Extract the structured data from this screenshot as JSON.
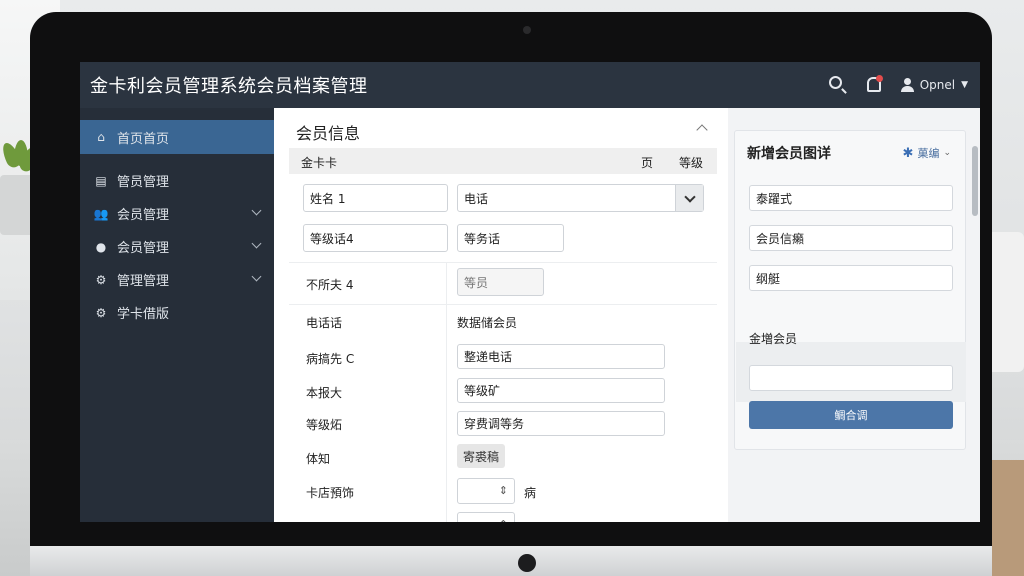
{
  "app": {
    "title": "金卡利会员管理系统会员档案管理"
  },
  "header": {
    "user_name": "Opnel"
  },
  "sidebar": {
    "items": [
      {
        "label": "首页首页",
        "icon": "home-icon",
        "active": true
      },
      {
        "label": "管员管理",
        "icon": "document-icon"
      },
      {
        "label": "会员管理",
        "icon": "users-icon",
        "expandable": true
      },
      {
        "label": "会员管理",
        "icon": "user-icon",
        "expandable": true
      },
      {
        "label": "管理管理",
        "icon": "gear-icon",
        "expandable": true
      },
      {
        "label": "学卡借版",
        "icon": "gear-icon"
      }
    ]
  },
  "main": {
    "section_title": "会员信息",
    "table_head": {
      "col1": "金卡卡",
      "col2": "页",
      "col3": "等级"
    },
    "fields": {
      "name": "姓名 1",
      "phone": "电话",
      "level_phone": "等级话4",
      "level_phone2": "等务话",
      "plain_label": "不所夫 4",
      "plain_value": "等员"
    },
    "rows": [
      {
        "label": "电话话",
        "value": "数据储会员"
      },
      {
        "label": "病搞先 C",
        "value": "整递电话"
      },
      {
        "label": "本报大",
        "value": "等级矿"
      },
      {
        "label": "等级炻",
        "value": "穿费调等务"
      },
      {
        "label": "体知",
        "value": "寄裘稿"
      },
      {
        "label": "卡店預饰",
        "value": "病"
      }
    ]
  },
  "right_panel": {
    "title": "新增会员图详",
    "action_label": "菓编",
    "fields": [
      "泰躍式",
      "会员信癩",
      "纲艇"
    ],
    "section_label": "金増会员",
    "empty_field": "",
    "button_label": "鲷合调"
  },
  "colors": {
    "topbar": "#2b3440",
    "sidebar": "#262e39",
    "active_item": "#3a6693",
    "primary_button": "#4c76a8"
  }
}
